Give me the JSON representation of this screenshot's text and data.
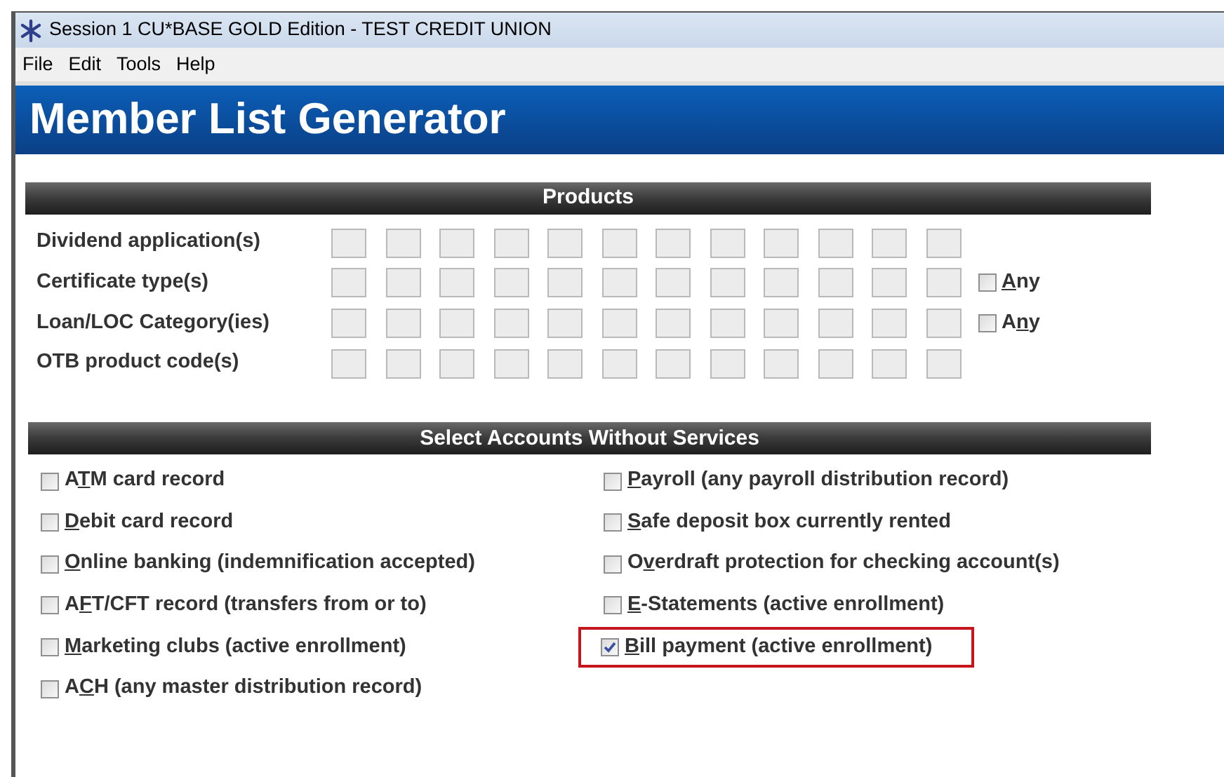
{
  "window": {
    "title": "Session 1 CU*BASE GOLD Edition - TEST CREDIT UNION"
  },
  "menu": [
    "File",
    "Edit",
    "Tools",
    "Help"
  ],
  "page_title": "Member List Generator",
  "products": {
    "title": "Products",
    "rows": [
      {
        "label": "Dividend application(s)"
      },
      {
        "label": "Certificate type(s)",
        "any": {
          "key": "A",
          "after": "ny",
          "checked": false
        }
      },
      {
        "label": "Loan/LOC Category(ies)",
        "any": {
          "before": "A",
          "key": "n",
          "after": "y",
          "checked": false
        }
      },
      {
        "label": "OTB product code(s)"
      }
    ]
  },
  "services": {
    "title": "Select Accounts Without Services",
    "left": [
      {
        "before": "A",
        "key": "T",
        "after": "M card record",
        "checked": false,
        "highlighted": false
      },
      {
        "key": "D",
        "after": "ebit card record",
        "checked": false,
        "highlighted": false
      },
      {
        "key": "O",
        "after": "nline banking (indemnification accepted)",
        "checked": false,
        "highlighted": false
      },
      {
        "before": "A",
        "key": "F",
        "after": "T/CFT record (transfers from or to)",
        "checked": false,
        "highlighted": false
      },
      {
        "key": "M",
        "after": "arketing clubs (active enrollment)",
        "checked": false,
        "highlighted": false
      },
      {
        "before": "A",
        "key": "C",
        "after": "H (any master distribution record)",
        "checked": false,
        "highlighted": false
      }
    ],
    "right": [
      {
        "key": "P",
        "after": "ayroll (any payroll distribution record)",
        "checked": false,
        "highlighted": false
      },
      {
        "key": "S",
        "after": "afe deposit box currently rented",
        "checked": false,
        "highlighted": false
      },
      {
        "before": "O",
        "key": "v",
        "after": "erdraft protection for checking account(s)",
        "checked": false,
        "highlighted": false
      },
      {
        "key": "E",
        "after": "-Statements (active enrollment)",
        "checked": false,
        "highlighted": false
      },
      {
        "key": "B",
        "after": "ill payment (active enrollment)",
        "checked": true,
        "highlighted": true
      }
    ]
  }
}
